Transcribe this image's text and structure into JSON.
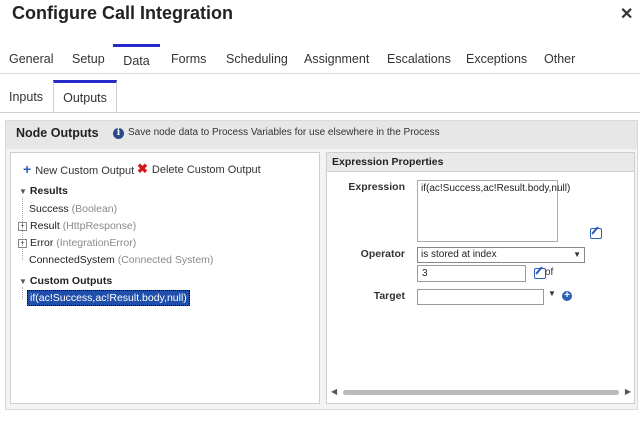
{
  "dialog": {
    "title": "Configure Call Integration",
    "close_glyph": "✕"
  },
  "tabs": [
    {
      "label": "General"
    },
    {
      "label": "Setup"
    },
    {
      "label": "Data"
    },
    {
      "label": "Forms"
    },
    {
      "label": "Scheduling"
    },
    {
      "label": "Assignment"
    },
    {
      "label": "Escalations"
    },
    {
      "label": "Exceptions"
    },
    {
      "label": "Other"
    }
  ],
  "active_tab": "Data",
  "subtabs": [
    {
      "label": "Inputs"
    },
    {
      "label": "Outputs"
    }
  ],
  "active_subtab": "Outputs",
  "node_outputs": {
    "title": "Node Outputs",
    "description": "Save node data to Process Variables for use elsewhere in the Process"
  },
  "toolbar": {
    "new_label": "New Custom Output",
    "delete_label": "Delete Custom Output"
  },
  "tree": {
    "results_label": "Results",
    "results": [
      {
        "name": "Success",
        "type": "(Boolean)"
      },
      {
        "name": "Result",
        "type": "(HttpResponse)"
      },
      {
        "name": "Error",
        "type": "(IntegrationError)"
      },
      {
        "name": "ConnectedSystem",
        "type": "(Connected System)"
      }
    ],
    "custom_label": "Custom Outputs",
    "custom": [
      {
        "name": "if(ac!Success,ac!Result.body,null)"
      }
    ]
  },
  "expression_properties": {
    "header": "Expression Properties",
    "expression_label": "Expression",
    "expression_value": "if(ac!Success,ac!Result.body,null)",
    "operator_label": "Operator",
    "operator_value": "is stored at index",
    "index_value": "3",
    "of_label": "of",
    "target_label": "Target",
    "target_value": ""
  },
  "colors": {
    "accent": "#2929c8",
    "selection": "#1f4faa",
    "delete": "#d01818",
    "link_blue": "#2b5fb8"
  }
}
